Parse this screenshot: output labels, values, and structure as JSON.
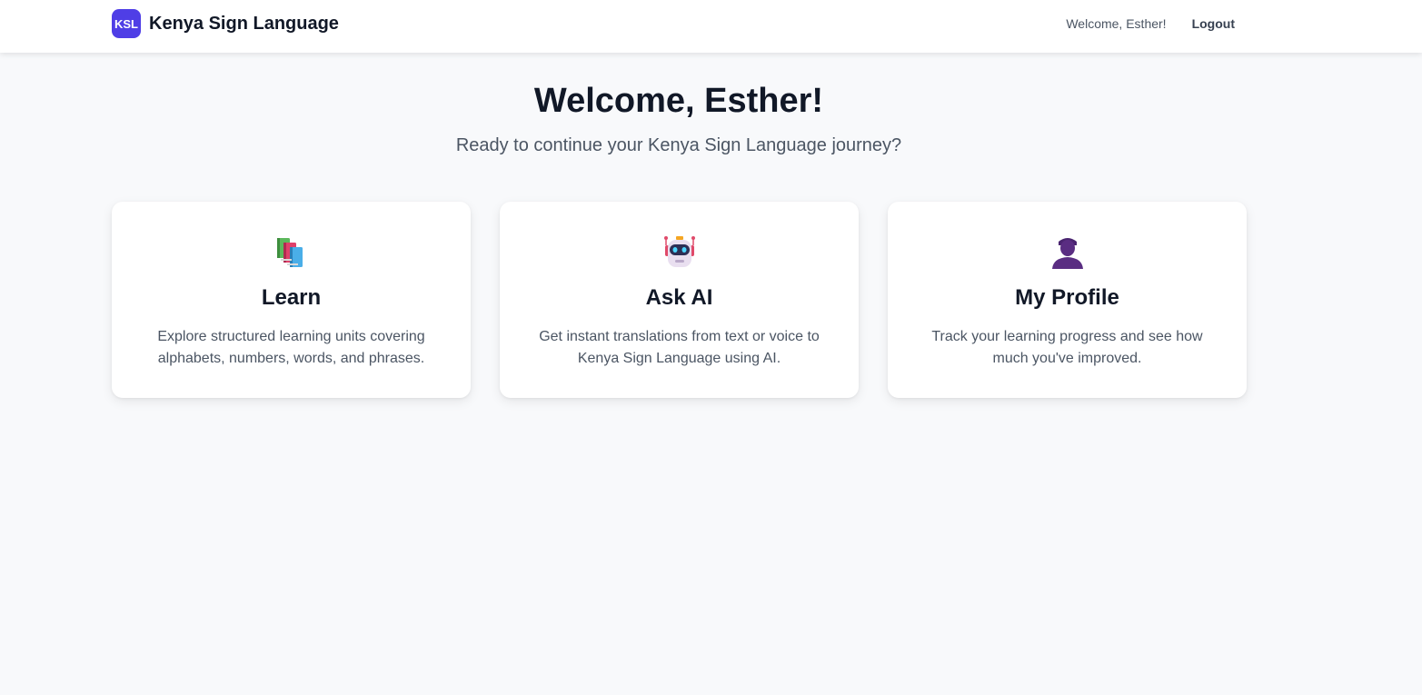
{
  "navbar": {
    "logo_text": "KSL",
    "brand_name": "Kenya Sign Language",
    "welcome_text": "Welcome, Esther!",
    "logout_label": "Logout"
  },
  "hero": {
    "title": "Welcome, Esther!",
    "subtitle": "Ready to continue your Kenya Sign Language journey?"
  },
  "cards": [
    {
      "icon": "books-icon",
      "title": "Learn",
      "description": "Explore structured learning units covering alphabets, numbers, words, and phrases."
    },
    {
      "icon": "robot-icon",
      "title": "Ask AI",
      "description": "Get instant translations from text or voice to Kenya Sign Language using AI."
    },
    {
      "icon": "user-silhouette-icon",
      "title": "My Profile",
      "description": "Track your learning progress and see how much you've improved."
    }
  ],
  "colors": {
    "brand": "#4f3ee6",
    "background": "#f8f9fb",
    "text_primary": "#111827",
    "text_secondary": "#4b5563"
  }
}
